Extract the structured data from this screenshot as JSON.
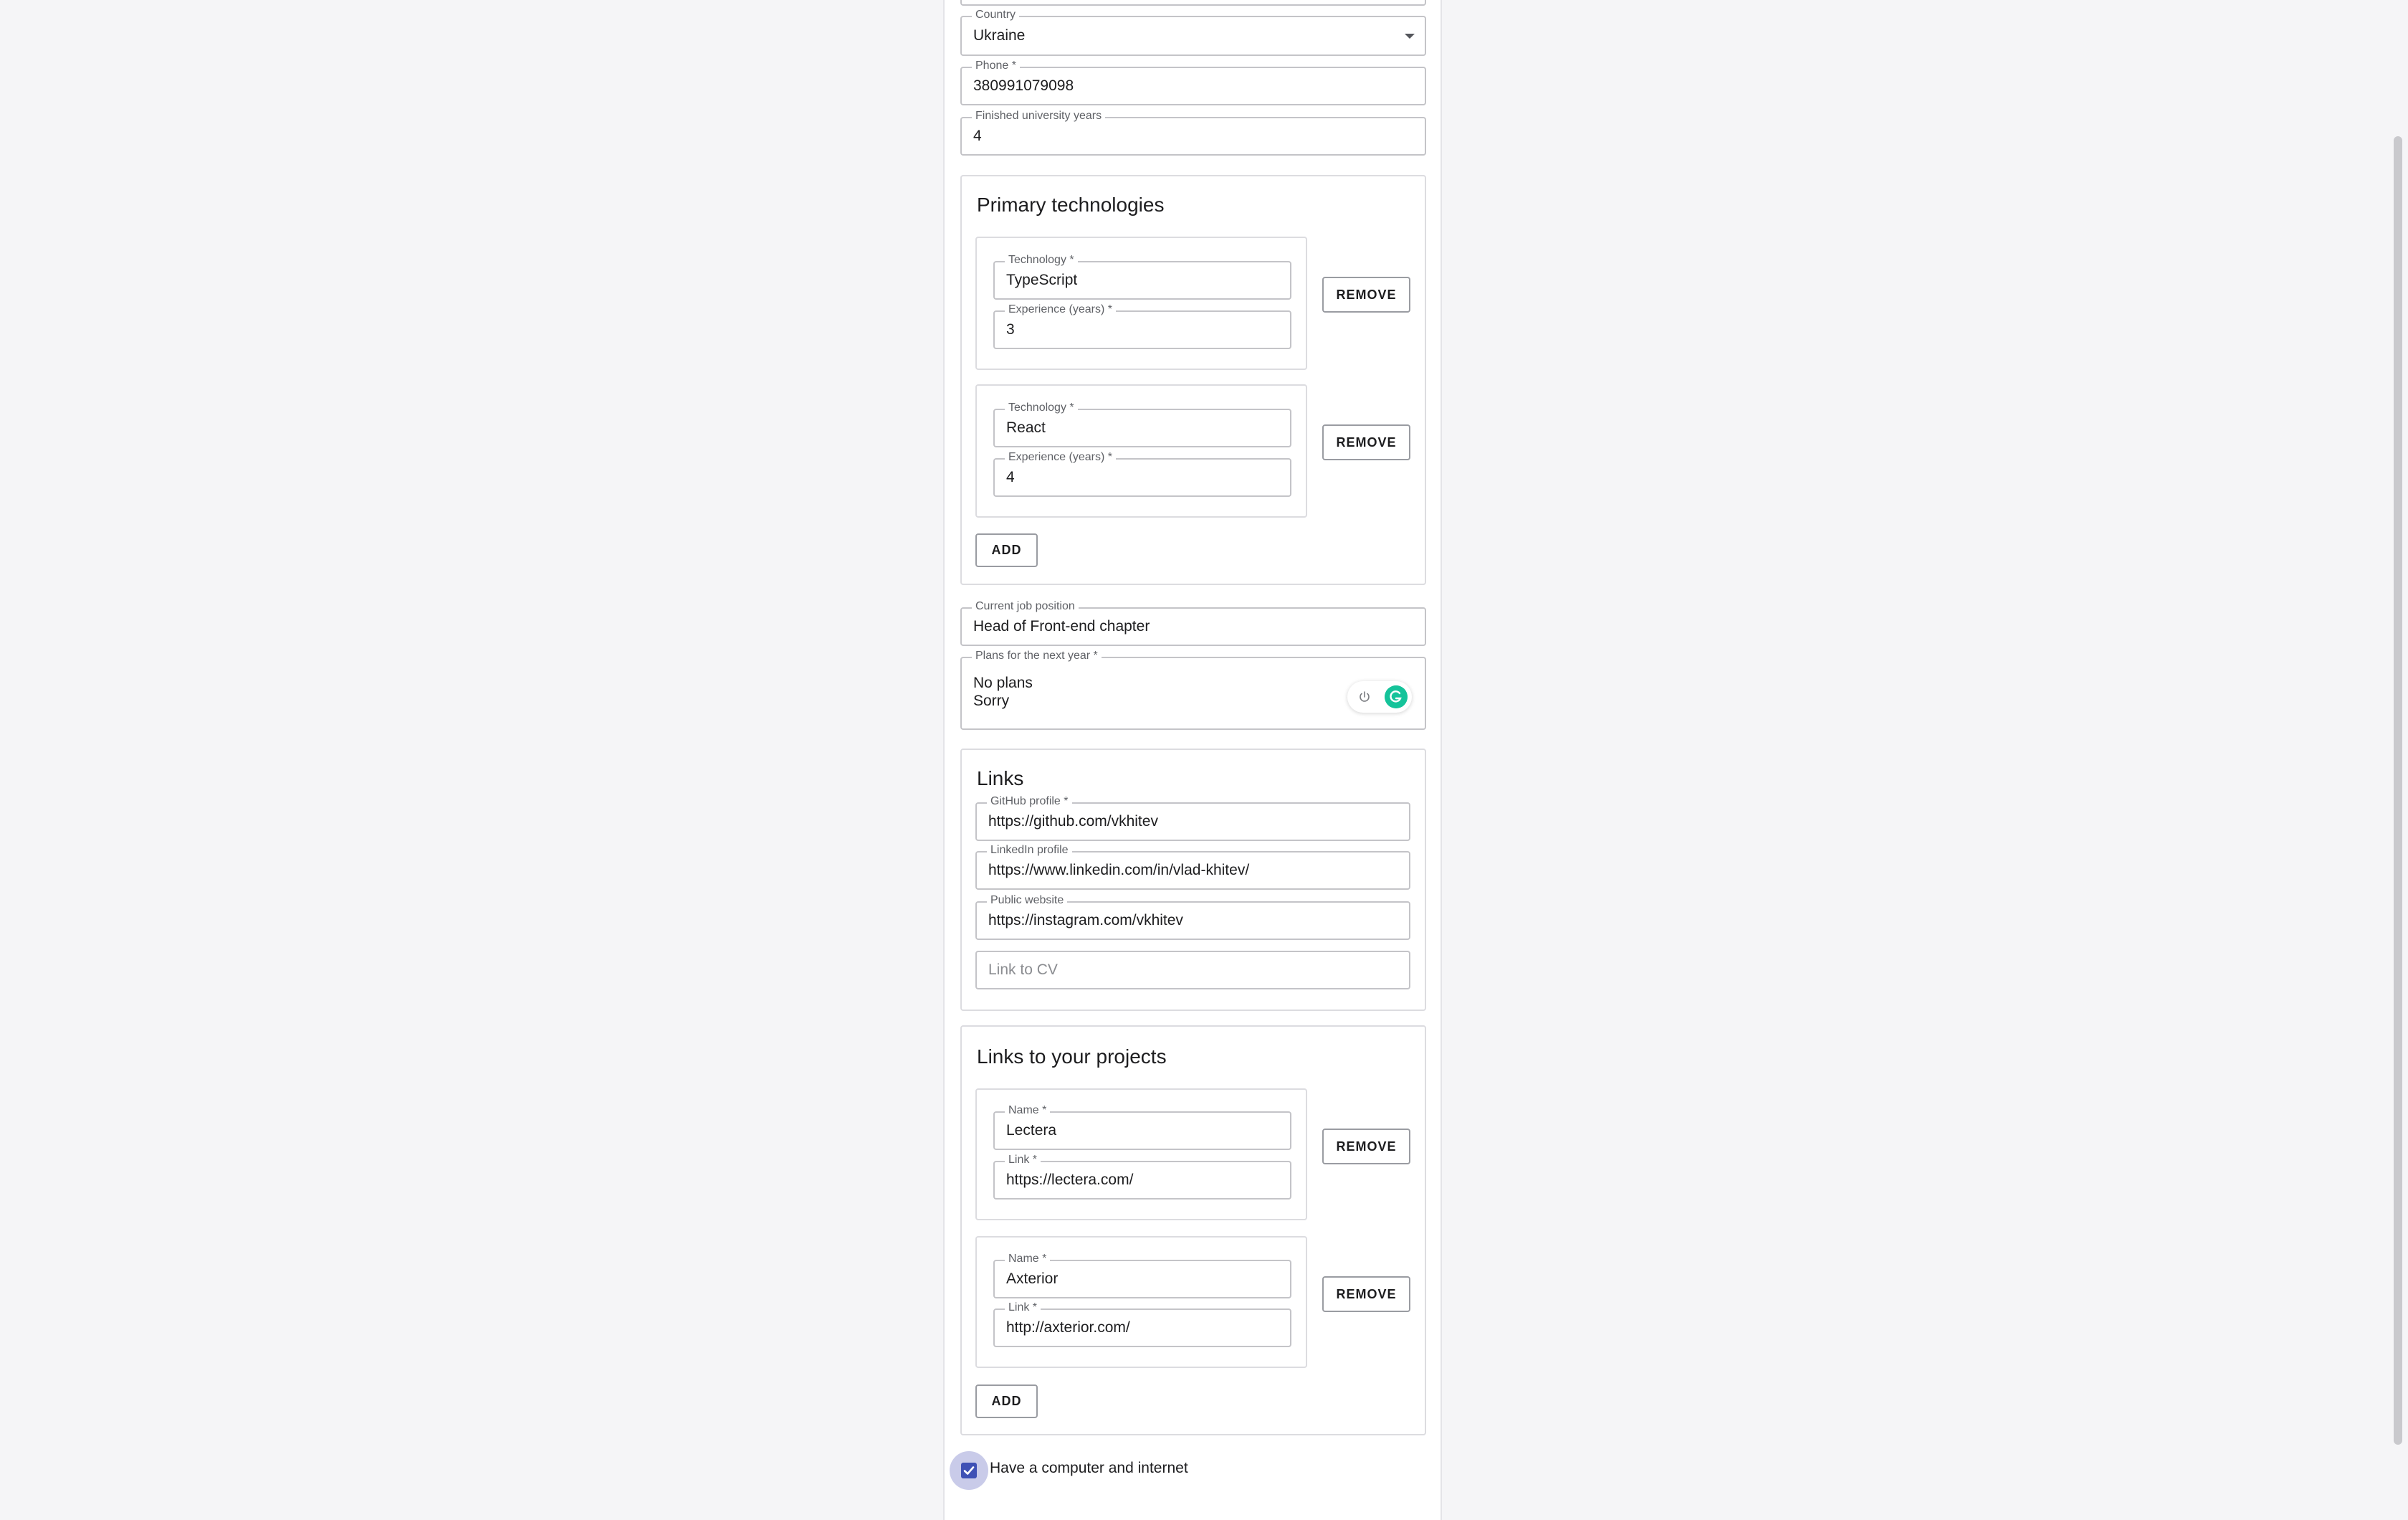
{
  "form": {
    "country": {
      "label": "Country",
      "value": "Ukraine"
    },
    "phone": {
      "label": "Phone *",
      "value": "380991079098"
    },
    "university_years": {
      "label": "Finished university years",
      "value": "4"
    },
    "primary_technologies": {
      "title": "Primary technologies",
      "items": [
        {
          "tech_label": "Technology *",
          "tech_value": "TypeScript",
          "exp_label": "Experience (years) *",
          "exp_value": "3",
          "remove_label": "REMOVE"
        },
        {
          "tech_label": "Technology *",
          "tech_value": "React",
          "exp_label": "Experience (years) *",
          "exp_value": "4",
          "remove_label": "REMOVE"
        }
      ],
      "add_label": "ADD"
    },
    "current_job": {
      "label": "Current job position",
      "value": "Head of Front-end chapter"
    },
    "plans": {
      "label": "Plans for the next year *",
      "lines": [
        "No plans",
        "Sorry"
      ]
    },
    "links": {
      "title": "Links",
      "github": {
        "label": "GitHub profile *",
        "value": "https://github.com/vkhitev"
      },
      "linkedin": {
        "label": "LinkedIn profile",
        "value": "https://www.linkedin.com/in/vlad-khitev/"
      },
      "website": {
        "label": "Public website",
        "value": "https://instagram.com/vkhitev"
      },
      "cv": {
        "placeholder": "Link to CV"
      }
    },
    "projects": {
      "title": "Links to your projects",
      "items": [
        {
          "name_label": "Name *",
          "name_value": "Lectera",
          "link_label": "Link *",
          "link_value": "https://lectera.com/",
          "remove_label": "REMOVE"
        },
        {
          "name_label": "Name *",
          "name_value": "Axterior",
          "link_label": "Link *",
          "link_value": "http://axterior.com/",
          "remove_label": "REMOVE"
        }
      ],
      "add_label": "ADD"
    },
    "computer_checkbox": {
      "label": "Have a computer and internet",
      "checked": true
    }
  },
  "icons": [
    "chevron-down-icon",
    "power-icon",
    "grammarly-icon",
    "check-icon"
  ],
  "colors": {
    "accent": "#3f51b5",
    "grammarly": "#15c39a"
  }
}
